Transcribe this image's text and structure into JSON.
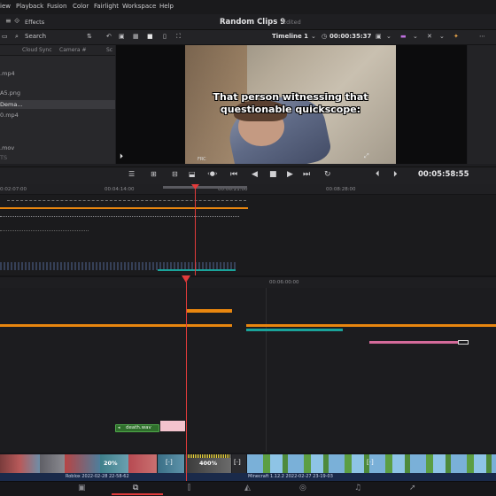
{
  "menu": [
    "iew",
    "Playback",
    "Fusion",
    "Color",
    "Fairlight",
    "Workspace",
    "Help"
  ],
  "header": {
    "project_title": "Random Clips 9",
    "edited": "Edited",
    "effects": "Effects"
  },
  "toolbar": {
    "search": "Search",
    "timeline": "Timeline 1",
    "timecode": "00:00:35:37"
  },
  "media_pool": {
    "columns": [
      "Cloud Sync",
      "Camera #",
      "Sc"
    ],
    "files": [
      ".mp4",
      "A5.png",
      "Dema...",
      "0.mp4",
      ".mov",
      "TS"
    ]
  },
  "viewer": {
    "caption": "That person witnessing that questionable quickscope:",
    "watermark": "FRC"
  },
  "transport": {
    "timecode": "00:05:58:55"
  },
  "ruler_top": [
    "0:02:07:00",
    "00:04:14:00",
    "00:06:21:00",
    "00:08:28:00"
  ],
  "ruler_bottom": [
    "00:06:00:00"
  ],
  "clips": {
    "audio_clip": "death.wav"
  },
  "strip": {
    "pct1": "20%",
    "pct2": "400%",
    "label1": "Roblox 2022-02-28 22-58-62",
    "label2": "Minecraft 1.12.2 2022-02-27 23-19-03"
  },
  "colors": {
    "orange": "#e8860f",
    "teal": "#1aa39a",
    "pink": "#d46a9a",
    "playhead": "#e23b3b",
    "audio_green": "#3f8f3a"
  }
}
